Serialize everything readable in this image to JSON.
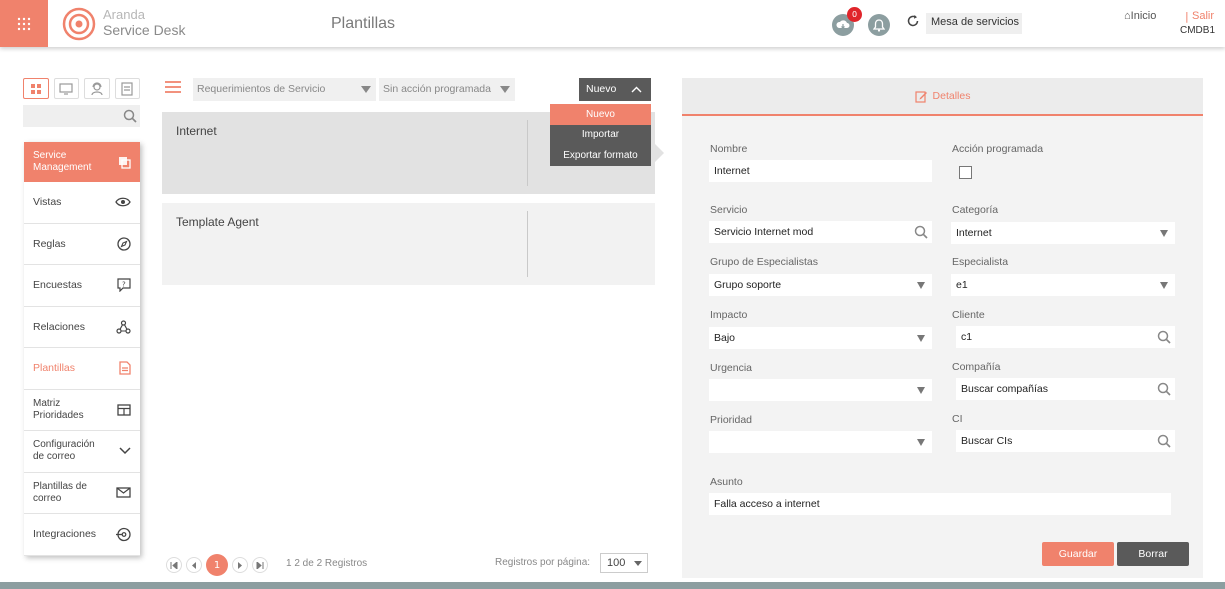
{
  "header": {
    "brand_top": "Aranda",
    "brand_bottom": "Service Desk",
    "page_title": "Plantillas",
    "badge_count": "0",
    "project_select": "Mesa de servicios",
    "home_link": "Inicio",
    "separator": "|",
    "logout_link": "Salir",
    "user_code": "CMDB1"
  },
  "sidebar": {
    "header_item": "Service Management",
    "items": [
      {
        "label": "Vistas",
        "icon": "eye-icon"
      },
      {
        "label": "Reglas",
        "icon": "compass-icon"
      },
      {
        "label": "Encuestas",
        "icon": "survey-icon"
      },
      {
        "label": "Relaciones",
        "icon": "relations-icon"
      },
      {
        "label": "Plantillas",
        "icon": "document-icon"
      },
      {
        "label": "Matriz Prioridades",
        "icon": "table-icon"
      },
      {
        "label": "Configuración de correo",
        "icon": "chevron-down-icon"
      },
      {
        "label": "Plantillas de correo",
        "icon": "envelope-icon"
      },
      {
        "label": "Integraciones",
        "icon": "integration-icon"
      }
    ]
  },
  "list": {
    "filter_type": "Requerimientos de Servicio",
    "filter_action": "Sin acción programada",
    "new_button": "Nuevo",
    "new_menu": [
      "Nuevo",
      "Importar",
      "Exportar formato"
    ],
    "cards": [
      "Internet",
      "Template Agent"
    ],
    "current_page": "1",
    "records_info": "1 2 de 2 Registros",
    "per_page_label": "Registros por página:",
    "per_page_value": "100"
  },
  "details": {
    "tab_label": "Detalles",
    "nombre_label": "Nombre",
    "nombre_value": "Internet",
    "accion_label": "Acción programada",
    "servicio_label": "Servicio",
    "servicio_value": "Servicio Internet mod",
    "categoria_label": "Categoría",
    "categoria_value": "Internet",
    "grupo_label": "Grupo de Especialistas",
    "grupo_value": "Grupo soporte",
    "especialista_label": "Especialista",
    "especialista_value": "e1",
    "impacto_label": "Impacto",
    "impacto_value": "Bajo",
    "cliente_label": "Cliente",
    "cliente_value": "c1",
    "urgencia_label": "Urgencia",
    "urgencia_value": "",
    "compania_label": "Compañía",
    "compania_value": "Buscar compañías",
    "prioridad_label": "Prioridad",
    "prioridad_value": "",
    "ci_label": "CI",
    "ci_value": "Buscar CIs",
    "asunto_label": "Asunto",
    "asunto_value": "Falla acceso a internet",
    "save_button": "Guardar",
    "delete_button": "Borrar"
  },
  "colors": {
    "accent": "#f0826c",
    "dark": "#5a5a5a",
    "icon_gray": "#8c9ea0"
  }
}
